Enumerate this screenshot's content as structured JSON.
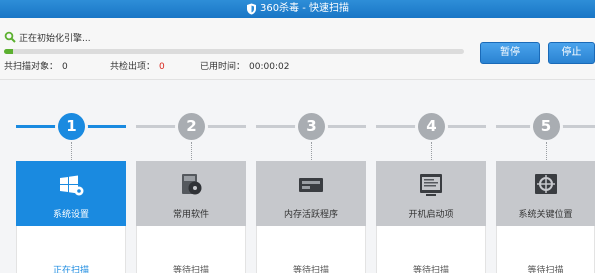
{
  "titlebar": {
    "title": "360杀毒 - 快速扫描",
    "icon": "shield-icon"
  },
  "status": {
    "message": "正在初始化引擎...",
    "progress_fraction": 0.02,
    "scanned_label": "共扫描对象：",
    "scanned_value": "0",
    "found_label": "共检出项：",
    "found_value": "0",
    "time_label": "已用时间：",
    "time_value": "00:00:02"
  },
  "buttons": {
    "pause": "暂停",
    "stop": "停止"
  },
  "steps": [
    {
      "number": "1",
      "label": "系统设置",
      "state": "正在扫描",
      "icon": "windows-settings-icon"
    },
    {
      "number": "2",
      "label": "常用软件",
      "state": "等待扫描",
      "icon": "software-disc-icon"
    },
    {
      "number": "3",
      "label": "内存活跃程序",
      "state": "等待扫描",
      "icon": "memory-icon"
    },
    {
      "number": "4",
      "label": "开机启动项",
      "state": "等待扫描",
      "icon": "startup-icon"
    },
    {
      "number": "5",
      "label": "系统关键位置",
      "state": "等待扫描",
      "icon": "key-location-icon"
    }
  ],
  "colors": {
    "accent": "#1a8ae0",
    "progress": "#5cb030",
    "alert": "#d9261c"
  }
}
